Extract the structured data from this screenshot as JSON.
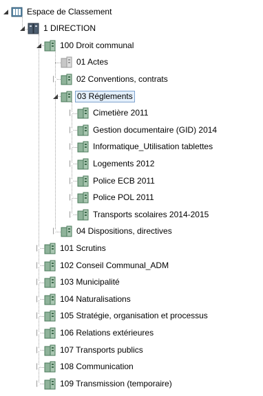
{
  "tree": [
    {
      "label": "Espace de Classement",
      "level": 0,
      "state": "expanded",
      "icon": "root-icon",
      "name": "tree-item-espace-de-classement"
    },
    {
      "label": "1 DIRECTION",
      "level": 1,
      "state": "expanded",
      "icon": "binder-icon",
      "name": "tree-item-1-direction"
    },
    {
      "label": "100 Droit communal",
      "level": 2,
      "state": "expanded",
      "icon": "folder-icon",
      "name": "tree-item-100"
    },
    {
      "label": "01 Actes",
      "level": 3,
      "state": "none",
      "icon": "folder-grey-icon",
      "name": "tree-item-01-actes"
    },
    {
      "label": "02 Conventions, contrats",
      "level": 3,
      "state": "collapsed",
      "icon": "folder-icon",
      "name": "tree-item-02-conventions"
    },
    {
      "label": "03 Réglements",
      "level": 3,
      "state": "expanded",
      "icon": "folder-icon",
      "selected": true,
      "name": "tree-item-03-reglements"
    },
    {
      "label": "Cimetière 2011",
      "level": 4,
      "state": "collapsed",
      "icon": "folder-icon",
      "name": "tree-item-cimetiere"
    },
    {
      "label": "Gestion documentaire (GID) 2014",
      "level": 4,
      "state": "collapsed",
      "icon": "folder-icon",
      "name": "tree-item-gestion-documentaire"
    },
    {
      "label": "Informatique_Utilisation tablettes",
      "level": 4,
      "state": "collapsed",
      "icon": "folder-icon",
      "name": "tree-item-informatique"
    },
    {
      "label": "Logements 2012",
      "level": 4,
      "state": "collapsed",
      "icon": "folder-icon",
      "name": "tree-item-logements"
    },
    {
      "label": "Police ECB 2011",
      "level": 4,
      "state": "collapsed",
      "icon": "folder-icon",
      "name": "tree-item-police-ecb"
    },
    {
      "label": "Police POL 2011",
      "level": 4,
      "state": "collapsed",
      "icon": "folder-icon",
      "name": "tree-item-police-pol"
    },
    {
      "label": "Transports scolaires 2014-2015",
      "level": 4,
      "state": "collapsed",
      "icon": "folder-icon",
      "name": "tree-item-transports-scolaires"
    },
    {
      "label": "04 Dispositions, directives",
      "level": 3,
      "state": "collapsed",
      "icon": "folder-icon",
      "name": "tree-item-04-dispositions"
    },
    {
      "label": "101 Scrutins",
      "level": 2,
      "state": "collapsed",
      "icon": "folder-icon",
      "name": "tree-item-101"
    },
    {
      "label": "102 Conseil Communal_ADM",
      "level": 2,
      "state": "collapsed",
      "icon": "folder-icon",
      "name": "tree-item-102"
    },
    {
      "label": "103 Municipalité",
      "level": 2,
      "state": "collapsed",
      "icon": "folder-icon",
      "name": "tree-item-103"
    },
    {
      "label": "104 Naturalisations",
      "level": 2,
      "state": "collapsed",
      "icon": "folder-icon",
      "name": "tree-item-104"
    },
    {
      "label": "105 Stratégie, organisation et processus",
      "level": 2,
      "state": "collapsed",
      "icon": "folder-icon",
      "name": "tree-item-105"
    },
    {
      "label": "106 Relations extérieures",
      "level": 2,
      "state": "collapsed",
      "icon": "folder-icon",
      "name": "tree-item-106"
    },
    {
      "label": "107 Transports publics",
      "level": 2,
      "state": "collapsed",
      "icon": "folder-icon",
      "name": "tree-item-107"
    },
    {
      "label": "108 Communication",
      "level": 2,
      "state": "collapsed",
      "icon": "folder-icon",
      "name": "tree-item-108"
    },
    {
      "label": "109 Transmission (temporaire)",
      "level": 2,
      "state": "collapsed",
      "icon": "folder-icon",
      "name": "tree-item-109"
    }
  ],
  "colors": {
    "selection_border": "#7da2ce",
    "selection_fill": "#e5f0fb",
    "folder_green": "#4a7a5a",
    "folder_grey": "#9a9a9a"
  }
}
